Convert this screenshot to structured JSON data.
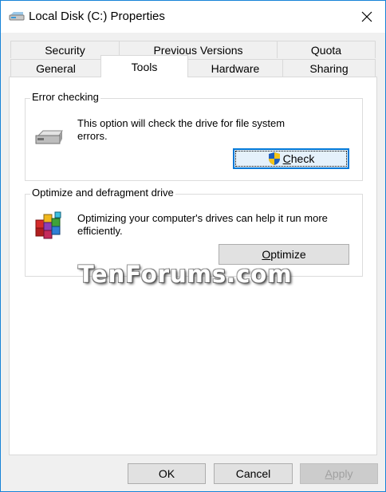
{
  "window": {
    "title": "Local Disk (C:) Properties",
    "title_icon": "drive-icon",
    "close_icon": "close-icon"
  },
  "tabs": {
    "row1": [
      "Security",
      "Previous Versions",
      "Quota"
    ],
    "row2": [
      "General",
      "Tools",
      "Hardware",
      "Sharing"
    ],
    "active": "Tools"
  },
  "error_checking": {
    "group_label": "Error checking",
    "icon": "hard-drive-icon",
    "description": "This option will check the drive for file system errors.",
    "button_label_underlined": "C",
    "button_label_rest": "heck",
    "button_icon": "uac-shield-icon"
  },
  "optimize": {
    "group_label": "Optimize and defragment drive",
    "icon": "defrag-icon",
    "description": "Optimizing your computer's drives can help it run more efficiently.",
    "button_label_underlined": "O",
    "button_label_rest": "ptimize"
  },
  "footer": {
    "ok_label": "OK",
    "cancel_label": "Cancel",
    "apply_label_underlined": "A",
    "apply_label_rest": "pply"
  },
  "watermark": "TenForums.com",
  "colors": {
    "accent": "#0078d7",
    "window_border": "#1783d7"
  }
}
